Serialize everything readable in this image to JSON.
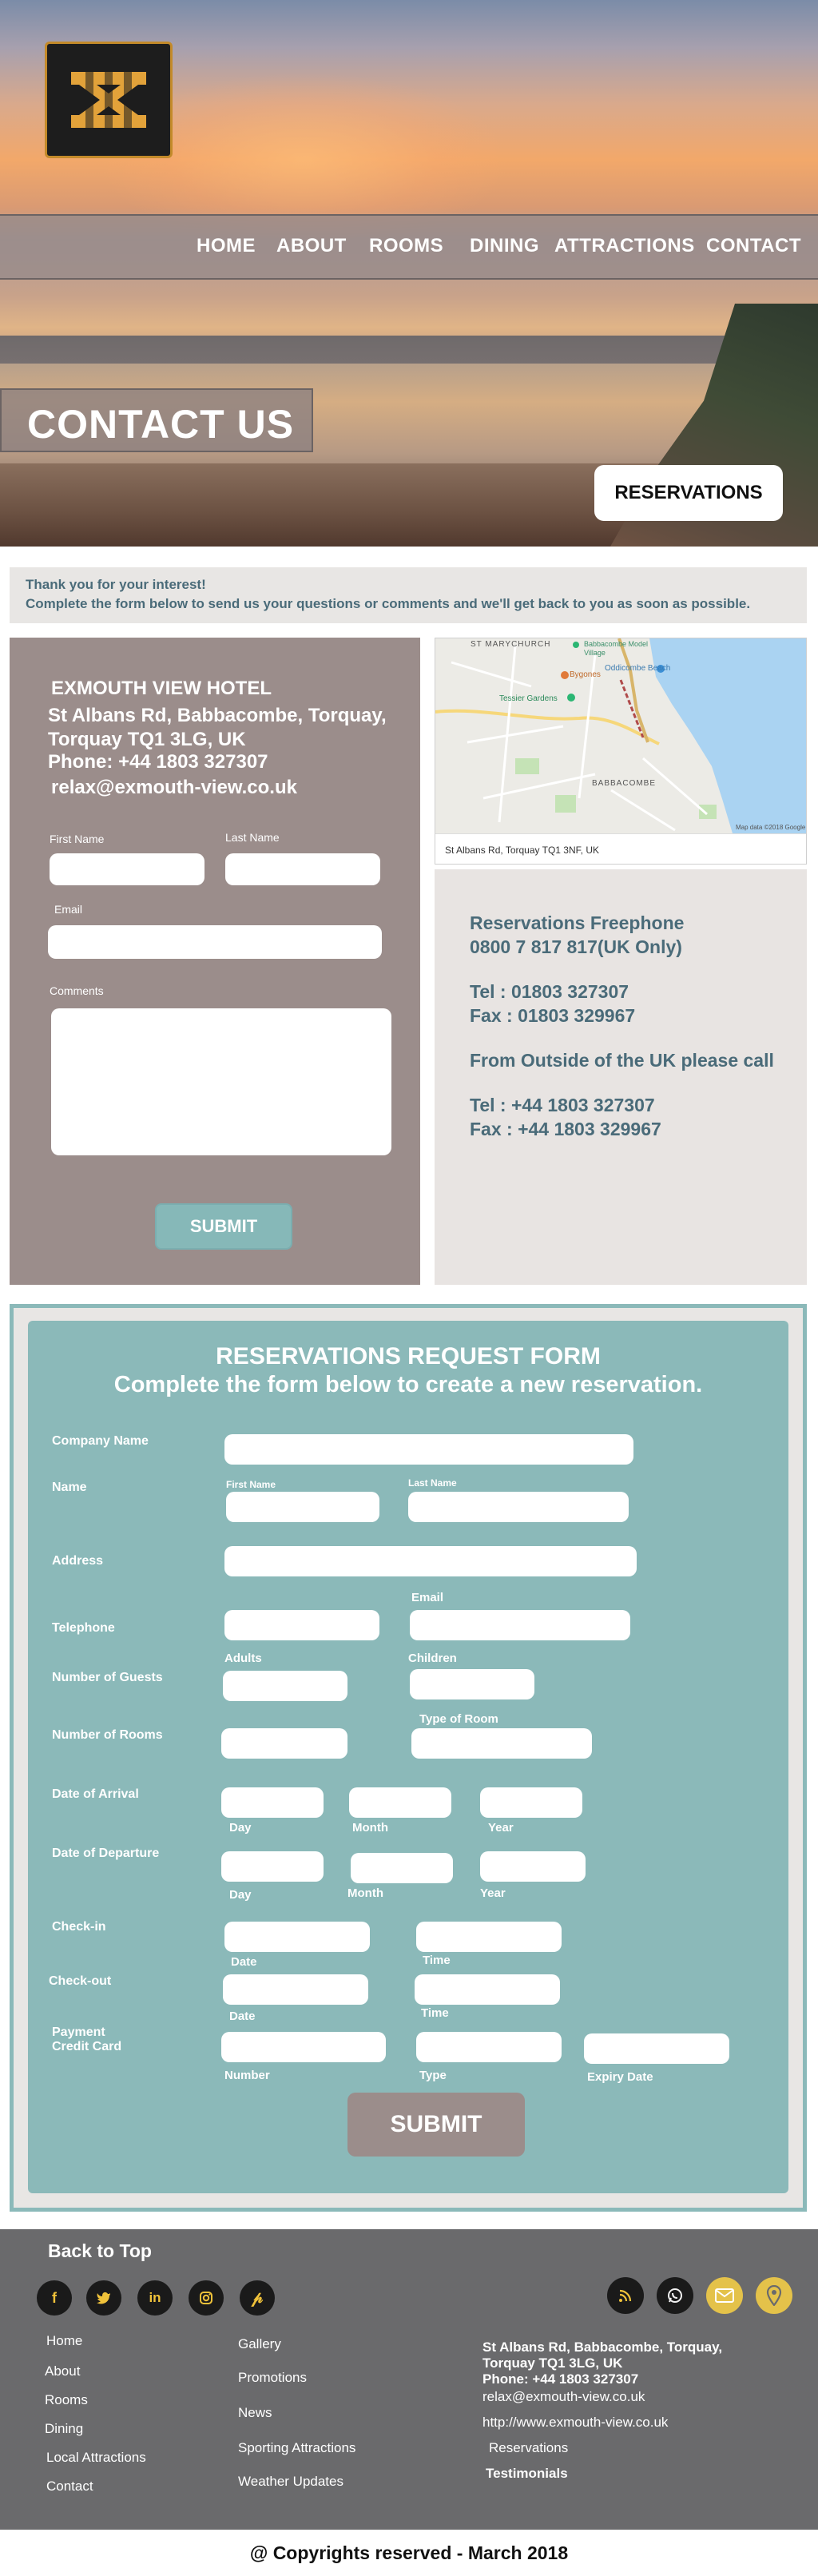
{
  "nav": {
    "items": [
      "HOME",
      "ABOUT",
      "ROOMS",
      "DINING",
      "ATTRACTIONS",
      "CONTACT"
    ]
  },
  "hero": {
    "page_title": "CONTACT US",
    "reservations_button": "RESERVATIONS"
  },
  "intro": {
    "line1": "Thank you for your interest!",
    "line2": "Complete the form below to send us your questions or comments and we'll get back to you as soon as possible."
  },
  "contact": {
    "hotel_name": "EXMOUTH VIEW HOTEL",
    "address_line1": "St Albans Rd, Babbacombe, Torquay,",
    "address_line2": "Torquay TQ1 3LG, UK",
    "phone": "Phone: +44 1803 327307",
    "email": "relax@exmouth-view.co.uk",
    "first_name_label": "First Name",
    "last_name_label": "Last Name",
    "email_label": "Email",
    "comments_label": "Comments",
    "submit_label": "SUBMIT"
  },
  "map": {
    "labels": [
      "ST MARYCHURCH",
      "Babbacombe Model Village",
      "Bygones",
      "Oddicombe Beach",
      "Tessier Gardens",
      "BABBACOMBE"
    ],
    "footer_credit": "Map data ©2018 Google",
    "caption": "St Albans Rd, Torquay TQ1 3NF, UK"
  },
  "reservations_info": {
    "freephone_title": "Reservations Freephone",
    "freephone_number": "0800 7 817 817(UK Only)",
    "tel": "Tel : 01803 327307",
    "fax": "Fax : 01803 329967",
    "outside_uk": "From Outside of the UK please call",
    "intl_tel": "Tel : +44 1803 327307",
    "intl_fax": "Fax : +44 1803 329967"
  },
  "reservation_form": {
    "title": "RESERVATIONS REQUEST FORM",
    "subtitle": "Complete the form below to create a new reservation.",
    "company_name": "Company Name",
    "name": "Name",
    "first_name": "First Name",
    "last_name": "Last Name",
    "address": "Address",
    "email": "Email",
    "telephone": "Telephone",
    "number_of_guests": "Number of Guests",
    "adults": "Adults",
    "children": "Children",
    "number_of_rooms": "Number of Rooms",
    "type_of_room": "Type of Room",
    "date_of_arrival": "Date of Arrival",
    "date_of_departure": "Date of Departure",
    "day": "Day",
    "month": "Month",
    "year": "Year",
    "check_in": "Check-in",
    "check_out": "Check-out",
    "date": "Date",
    "time": "Time",
    "payment_line1": "Payment",
    "payment_line2": "Credit Card",
    "number": "Number",
    "type": "Type",
    "expiry_date": "Expiry Date",
    "submit_label": "SUBMIT"
  },
  "footer": {
    "back_to_top": "Back to Top",
    "nav_col1": [
      "Home",
      "About",
      "Rooms",
      "Dining",
      "Local Attractions",
      "Contact"
    ],
    "nav_col2": [
      "Gallery",
      "Promotions",
      "News",
      "Sporting Attractions",
      "Weather Updates"
    ],
    "address_line1": "St Albans Rd, Babbacombe, Torquay,",
    "address_line2": "Torquay TQ1 3LG, UK",
    "phone": "Phone: +44 1803 327307",
    "email": "relax@exmouth-view.co.uk",
    "website": "http://www.exmouth-view.co.uk",
    "reservations": "Reservations",
    "testimonials": "Testimonials",
    "social_icons": [
      "facebook-icon",
      "twitter-icon",
      "linkedin-icon",
      "instagram-icon",
      "pinterest-icon",
      "rss-icon",
      "whatsapp-icon",
      "mail-icon",
      "location-pin-icon"
    ],
    "accent": "#e4c24a"
  },
  "copyright": "@ Copyrights reserved - March 2018",
  "colors": {
    "teal": "#8bb9b9",
    "taupe": "#9b8d8b",
    "slate_text": "#4a6b79",
    "footer_bg": "#6a6a6c"
  }
}
